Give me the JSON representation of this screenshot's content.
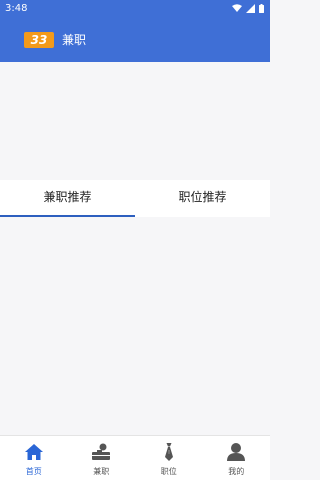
{
  "status_bar": {
    "time": "3:48",
    "icons": [
      "wifi-icon",
      "signal-icon",
      "battery-icon"
    ]
  },
  "app_bar": {
    "badge": "33",
    "title": "兼职"
  },
  "colors": {
    "primary": "#3f6fd6",
    "badge": "#f39a1a",
    "active_nav": "#2a66d6",
    "tab_indicator": "#2d5fbf"
  },
  "tabs": [
    {
      "label": "兼职推荐",
      "active": true
    },
    {
      "label": "职位推荐",
      "active": false
    }
  ],
  "bottom_nav": [
    {
      "label": "首页",
      "icon": "home-icon",
      "active": true
    },
    {
      "label": "兼职",
      "icon": "briefcase-icon",
      "active": false
    },
    {
      "label": "职位",
      "icon": "tie-icon",
      "active": false
    },
    {
      "label": "我的",
      "icon": "profile-icon",
      "active": false
    }
  ]
}
